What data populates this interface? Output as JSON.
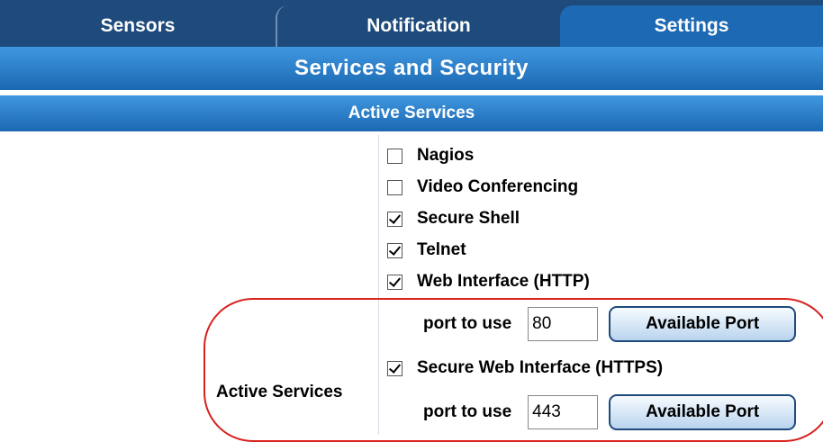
{
  "tabs": [
    {
      "label": "Sensors"
    },
    {
      "label": "Notification"
    },
    {
      "label": "Settings"
    }
  ],
  "page_title": "Services and Security",
  "section_title": "Active Services",
  "row_label": "Active Services",
  "services": [
    {
      "label": "Nagios",
      "checked": false
    },
    {
      "label": "Video Conferencing",
      "checked": false
    },
    {
      "label": "Secure Shell",
      "checked": true
    },
    {
      "label": "Telnet",
      "checked": true
    },
    {
      "label": "Web Interface (HTTP)",
      "checked": true
    },
    {
      "label": "Secure Web Interface (HTTPS)",
      "checked": true
    }
  ],
  "http_port": {
    "label": "port to use",
    "value": "80",
    "button": "Available Port"
  },
  "https_port": {
    "label": "port to use",
    "value": "443",
    "button": "Available Port"
  },
  "annotation_color": "#d8201d"
}
